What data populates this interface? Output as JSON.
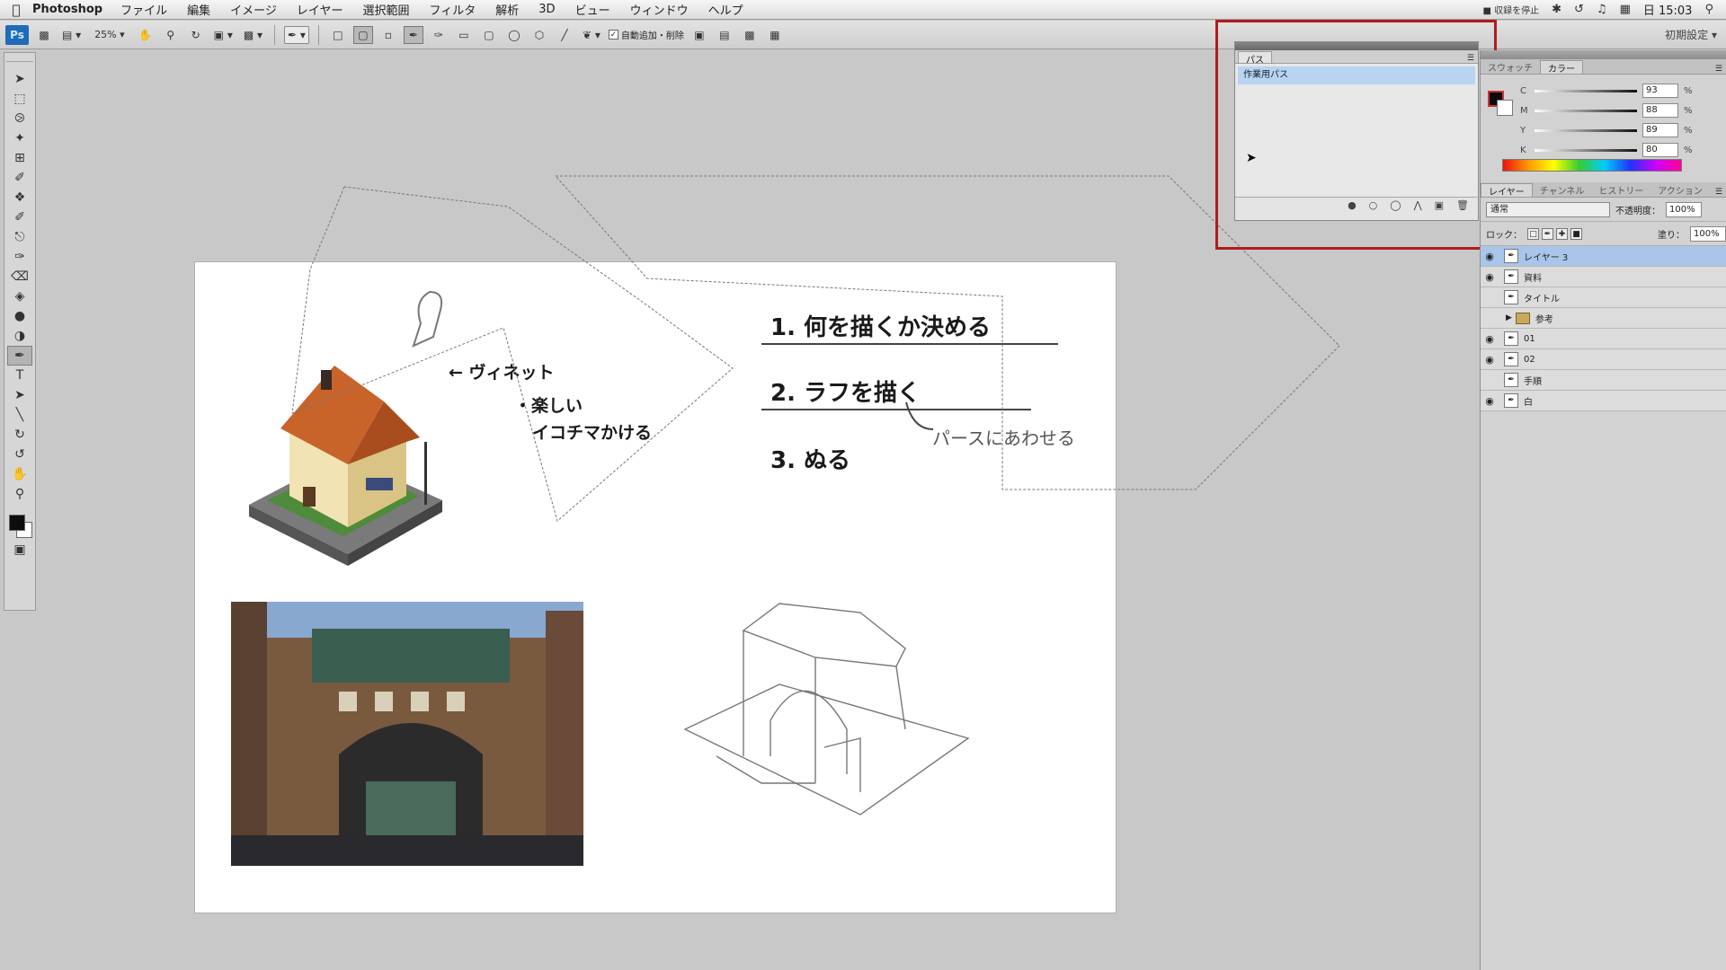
{
  "menubar": {
    "app_name": "Photoshop",
    "menus": [
      "ファイル",
      "編集",
      "イメージ",
      "レイヤー",
      "選択範囲",
      "フィルタ",
      "解析",
      "3D",
      "ビュー",
      "ウィンドウ",
      "ヘルプ"
    ],
    "record_stop": "■ 収録を停止",
    "clock": "日 15:03",
    "icons": [
      "apple-icon",
      "bluetooth-icon",
      "time-machine-icon",
      "volume-icon",
      "input-menu-icon",
      "spotlight-search-icon"
    ]
  },
  "options_bar": {
    "logo": "Ps",
    "zoom": "25%",
    "auto_add_delete_label": "自動追加・削除",
    "workspace": "初期設定"
  },
  "paths_panel": {
    "tab": "パス",
    "paths": [
      "作業用パス"
    ]
  },
  "color_panel": {
    "tabs": [
      "スウォッチ",
      "カラー"
    ],
    "active_tab": "カラー",
    "fg_color": "#0a0a0a",
    "channels": [
      {
        "label": "C",
        "value": "93",
        "unit": "%"
      },
      {
        "label": "M",
        "value": "88",
        "unit": "%"
      },
      {
        "label": "Y",
        "value": "89",
        "unit": "%"
      },
      {
        "label": "K",
        "value": "80",
        "unit": "%"
      }
    ]
  },
  "layers_panel": {
    "tabs": [
      "レイヤー",
      "チャンネル",
      "ヒストリー",
      "アクション"
    ],
    "active_tab": "レイヤー",
    "blend_mode": "通常",
    "opacity_label": "不透明度：",
    "opacity": "100%",
    "lock_label": "ロック：",
    "fill_label": "塗り：",
    "fill": "100%",
    "layers": [
      {
        "name": "レイヤー 3",
        "visible": true,
        "selected": true
      },
      {
        "name": "資料",
        "visible": true
      },
      {
        "name": "タイトル",
        "visible": false
      },
      {
        "name": "参考",
        "visible": false,
        "group": true
      },
      {
        "name": "01",
        "visible": true
      },
      {
        "name": "02",
        "visible": true
      },
      {
        "name": "手順",
        "visible": false
      },
      {
        "name": "白",
        "visible": true
      }
    ]
  },
  "canvas": {
    "notes": {
      "arrow_note": "← ヴィネット",
      "fun": "・楽しい",
      "squeeze": "イコチマかける",
      "step1": "1. 何を描くか決める",
      "step2": "2. ラフを描く",
      "step3": "3. ぬる",
      "perspective_note": "パースにあわせる"
    }
  },
  "colors": {
    "highlight": "#b01c1c",
    "selected_layer": "#a9c6ea",
    "selected_path": "#b8d4f0"
  }
}
